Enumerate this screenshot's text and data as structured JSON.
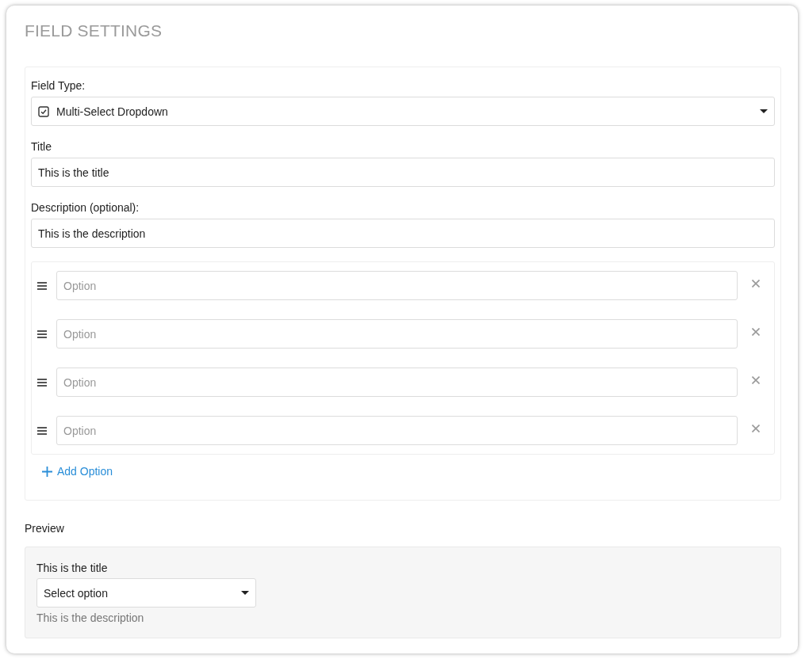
{
  "panel": {
    "title": "FIELD SETTINGS"
  },
  "settings": {
    "field_type": {
      "label": "Field Type:",
      "value": "Multi-Select Dropdown"
    },
    "title": {
      "label": "Title",
      "value": "This is the title"
    },
    "description": {
      "label": "Description (optional):",
      "value": "This is the description"
    },
    "options": [
      {
        "placeholder": "Option"
      },
      {
        "placeholder": "Option"
      },
      {
        "placeholder": "Option"
      },
      {
        "placeholder": "Option"
      }
    ],
    "add_option": {
      "label": "Add Option"
    }
  },
  "preview": {
    "label": "Preview",
    "title": "This is the title",
    "select": {
      "value": "Select option"
    },
    "description": "This is the description"
  }
}
